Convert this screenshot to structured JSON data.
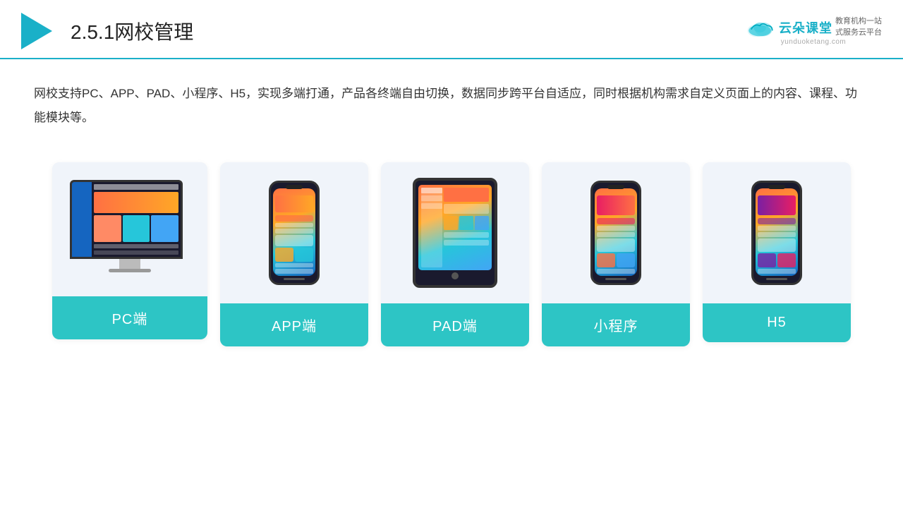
{
  "header": {
    "section_number": "2.5.1",
    "title": "网校管理",
    "logo_name": "云朵课堂",
    "logo_url": "yunduoketang.com",
    "logo_tagline_line1": "教育机构一站",
    "logo_tagline_line2": "式服务云平台"
  },
  "description": {
    "text": "网校支持PC、APP、PAD、小程序、H5，实现多端打通，产品各终端自由切换，数据同步跨平台自适应，同时根据机构需求自定义页面上的内容、课程、功能模块等。"
  },
  "cards": [
    {
      "id": "pc",
      "label": "PC端"
    },
    {
      "id": "app",
      "label": "APP端"
    },
    {
      "id": "pad",
      "label": "PAD端"
    },
    {
      "id": "miniapp",
      "label": "小程序"
    },
    {
      "id": "h5",
      "label": "H5"
    }
  ]
}
